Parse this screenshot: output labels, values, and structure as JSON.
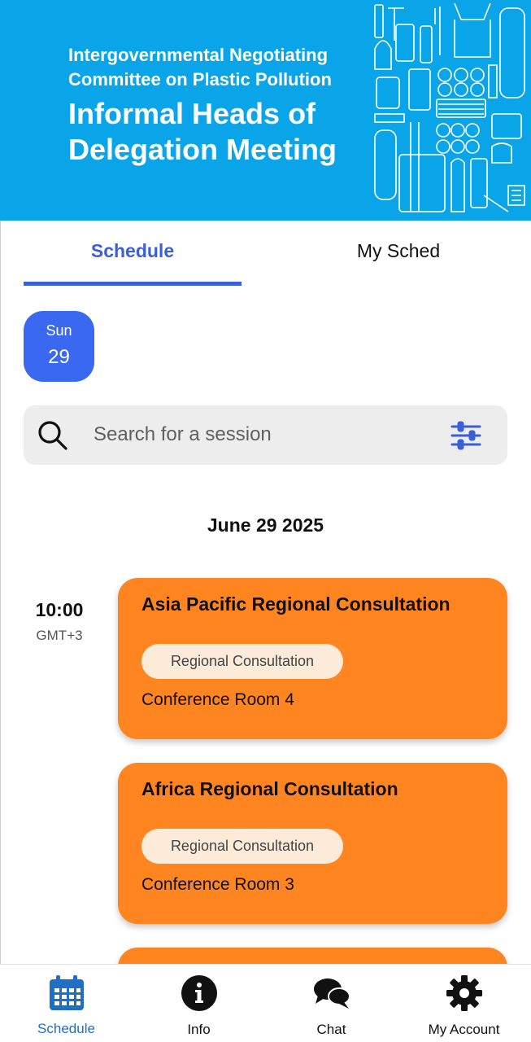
{
  "banner": {
    "subtitle_line1": "Intergovernmental Negotiating",
    "subtitle_line2": "Committee on Plastic Pollution",
    "title_line1": "Informal Heads of",
    "title_line2": "Delegation Meeting",
    "background_color": "#0aa5e8",
    "art_icon": "plastic-items-illustration-icon"
  },
  "tabs": [
    {
      "label": "Schedule",
      "active": true
    },
    {
      "label": "My Sched",
      "active": false
    }
  ],
  "accent_color": "#3a5fd6",
  "day_selector": {
    "weekday": "Sun",
    "day": "29"
  },
  "search": {
    "placeholder": "Search for a session",
    "value": "",
    "icon": "search-icon",
    "filter_icon": "filter-sliders-icon"
  },
  "date_heading": "June 29 2025",
  "time_slot": {
    "time": "10:00",
    "timezone": "GMT+3"
  },
  "sessions": [
    {
      "title": "Asia Pacific Regional Consultation",
      "tag": "Regional Consultation",
      "room": "Conference Room 4",
      "color": "#ff8520"
    },
    {
      "title": "Africa Regional Consultation",
      "tag": "Regional Consultation",
      "room": "Conference Room 3",
      "color": "#ff8520"
    }
  ],
  "bottom_nav": [
    {
      "label": "Schedule",
      "icon": "calendar-icon",
      "active": true
    },
    {
      "label": "Info",
      "icon": "info-icon",
      "active": false
    },
    {
      "label": "Chat",
      "icon": "chat-icon",
      "active": false
    },
    {
      "label": "My Account",
      "icon": "gear-icon",
      "active": false
    }
  ]
}
